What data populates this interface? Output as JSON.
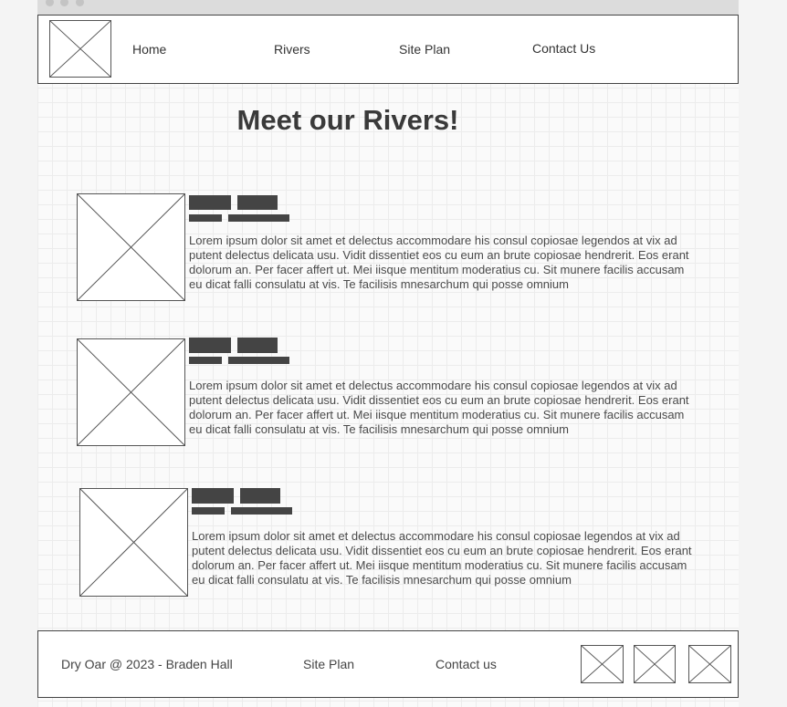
{
  "nav": {
    "items": [
      {
        "label": "Home"
      },
      {
        "label": "Rivers"
      },
      {
        "label": "Site Plan"
      },
      {
        "label": "Contact Us"
      }
    ]
  },
  "main": {
    "title": "Meet our Rivers!",
    "rivers": [
      {
        "body": "Lorem ipsum dolor sit amet et delectus accommodare his consul copiosae legendos at vix ad putent delectus delicata usu. Vidit dissentiet eos cu eum an brute copiosae hendrerit. Eos erant dolorum an. Per facer affert ut. Mei iisque mentitum moderatius cu. Sit munere facilis accusam eu dicat falli consulatu at vis. Te facilisis mnesarchum qui posse omnium"
      },
      {
        "body": "Lorem ipsum dolor sit amet et delectus accommodare his consul copiosae legendos at vix ad putent delectus delicata usu. Vidit dissentiet eos cu eum an brute copiosae hendrerit. Eos erant dolorum an. Per facer affert ut. Mei iisque mentitum moderatius cu. Sit munere facilis accusam eu dicat falli consulatu at vis. Te facilisis mnesarchum qui posse omnium"
      },
      {
        "body": "Lorem ipsum dolor sit amet et delectus accommodare his consul copiosae legendos at vix ad putent delectus delicata usu. Vidit dissentiet eos cu eum an brute copiosae hendrerit. Eos erant dolorum an. Per facer affert ut. Mei iisque mentitum moderatius cu. Sit munere facilis accusam eu dicat falli consulatu at vis. Te facilisis mnesarchum qui posse omnium"
      }
    ]
  },
  "footer": {
    "copyright": "Dry Oar @ 2023 - Braden Hall",
    "site_plan": "Site Plan",
    "contact": "Contact us"
  },
  "colors": {
    "page_background": "#f4f4f4",
    "wireframe_stroke": "#444444",
    "text_block": "#444444"
  }
}
